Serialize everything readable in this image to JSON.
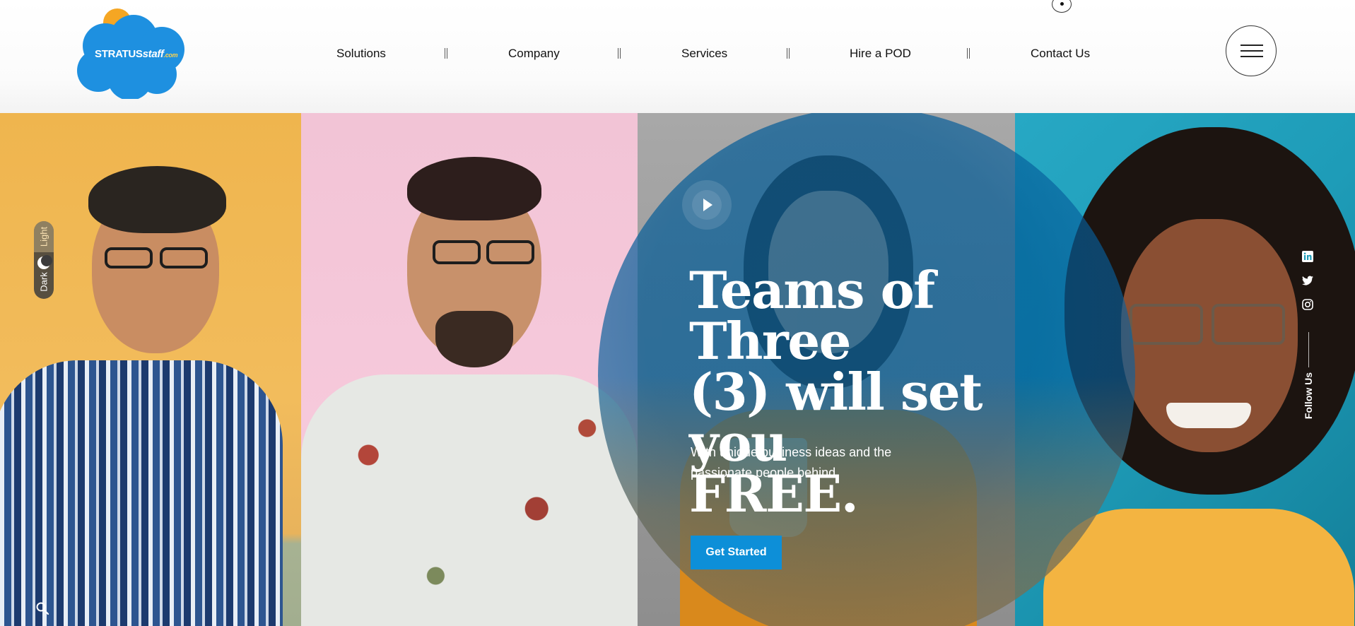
{
  "brand": {
    "logo_main": "STRATUS",
    "logo_staff": "staff",
    "logo_domain": ".com"
  },
  "nav": {
    "items": [
      {
        "label": "Solutions"
      },
      {
        "label": "Company"
      },
      {
        "label": "Services"
      },
      {
        "label": "Hire a POD"
      },
      {
        "label": "Contact Us"
      }
    ]
  },
  "hero": {
    "headline_line1": "Teams of Three",
    "headline_line2": "(3) will set you",
    "headline_line3": "FREE.",
    "subline_line1": "With unique business ideas and the",
    "subline_line2": "passionate people behind.",
    "cta_label": "Get Started"
  },
  "theme_toggle": {
    "light_label": "Light",
    "dark_label": "Dark"
  },
  "social": {
    "follow_label": "Follow Us",
    "icons": [
      "linkedin-icon",
      "twitter-icon",
      "instagram-icon"
    ]
  },
  "colors": {
    "accent": "#0d8fd8",
    "overlay": "#005a96",
    "logo_blue": "#1e90e0",
    "logo_sun": "#f5a623"
  }
}
